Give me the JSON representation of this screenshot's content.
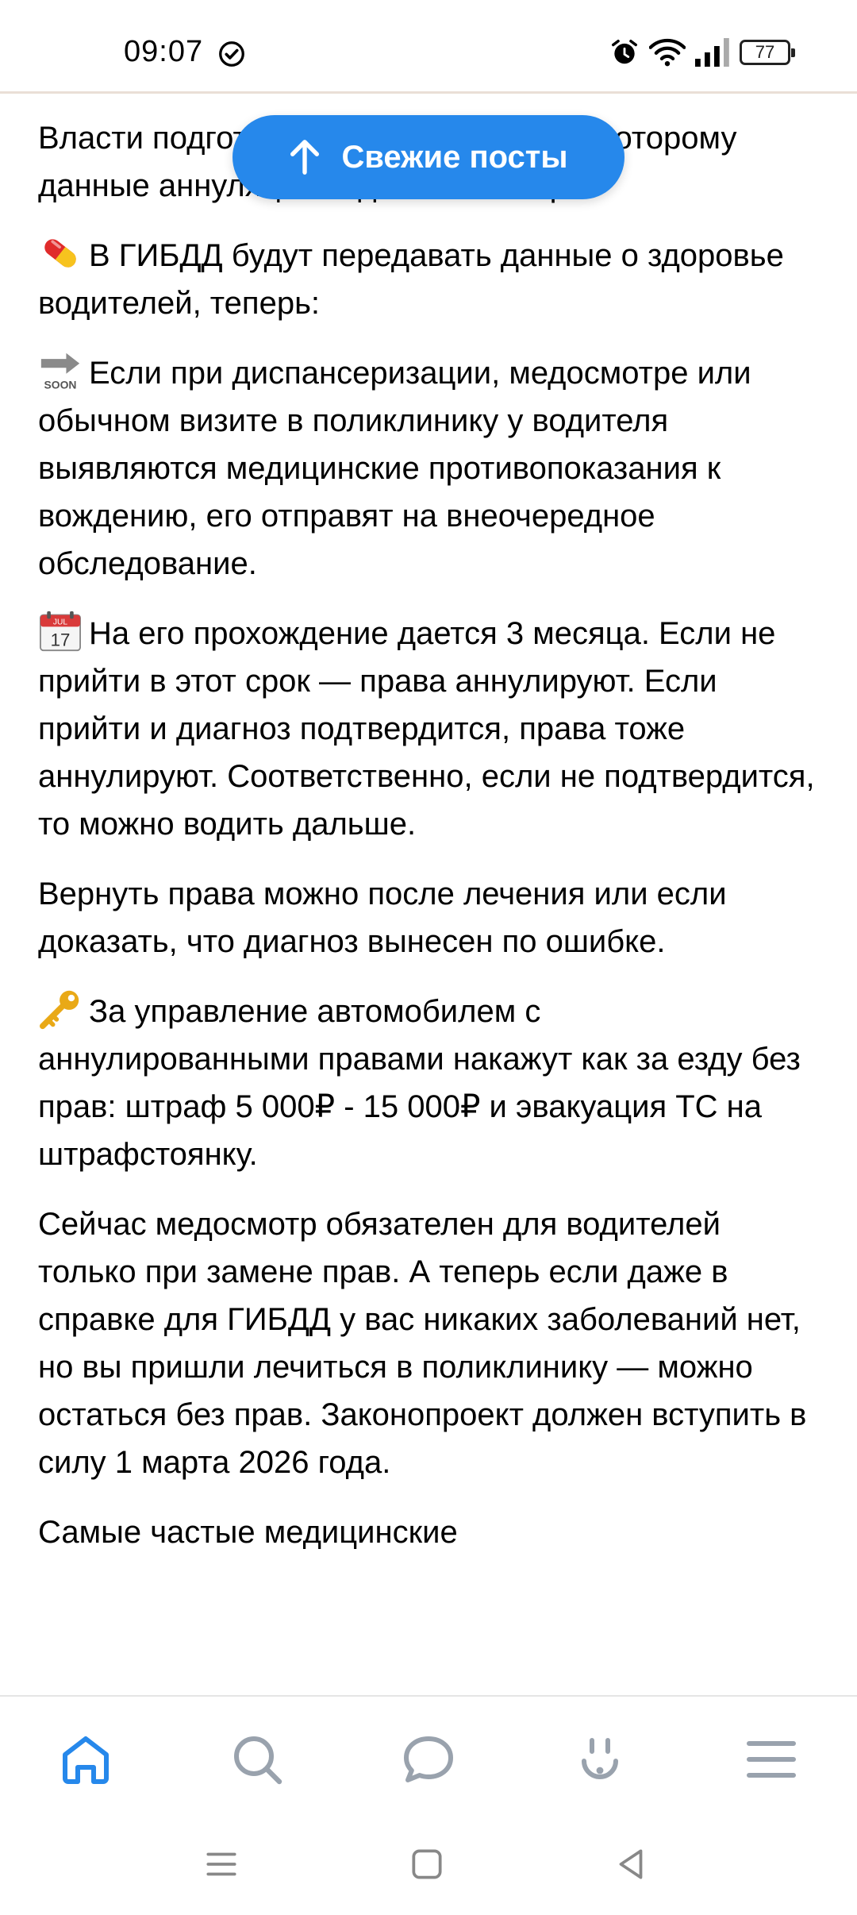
{
  "status_bar": {
    "time": "09:07",
    "battery_level": "77",
    "icons": [
      "check-circle-icon",
      "alarm-icon",
      "wifi-icon",
      "signal-icon",
      "battery-icon"
    ]
  },
  "fresh_posts": {
    "label": "Свежие посты",
    "icon": "arrow-up-icon"
  },
  "article": {
    "paragraphs": [
      {
        "text": "Власти подготовили законопроект, по которому данные аннуляции водительских прав"
      },
      {
        "icon": "pill-emoji",
        "text": "В ГИБДД будут передавать данные о здоровье водителей, теперь:"
      },
      {
        "icon": "soon-arrow-emoji",
        "text": "Если при диспансеризации, медосмотре или обычном визите в поликлинику у водителя выявляются медицинские противопоказания к вождению, его отправят на внеочередное обследование."
      },
      {
        "icon": "calendar-emoji",
        "text": "На его прохождение дается 3 месяца. Если не прийти в этот срок — права аннулируют. Если прийти и диагноз подтвердится, права тоже аннулируют. Соответственно, если не подтвердится, то можно водить дальше."
      },
      {
        "text": "Вернуть права можно после лечения или если доказать, что диагноз вынесен по ошибке."
      },
      {
        "icon": "key-emoji",
        "text": "За управление автомобилем с аннулированными правами накажут как за езду без прав: штраф 5 000₽ - 15 000₽ и эвакуация ТС на штрафстоянку."
      },
      {
        "text": "Сейчас медосмотр обязателен для водителей только при замене прав. А теперь если даже в справке для ГИБДД у вас никаких заболеваний нет, но вы пришли лечиться в поликлинику — можно остаться без прав. Законопроект должен вступить в силу 1 марта 2026 года."
      },
      {
        "text": "Самые частые медицинские"
      }
    ],
    "calendar_month": "JUL",
    "calendar_day": "17",
    "soon_label": "SOON"
  },
  "tabbar": {
    "items": [
      {
        "icon": "home-icon",
        "active": true
      },
      {
        "icon": "search-icon",
        "active": false
      },
      {
        "icon": "chat-icon",
        "active": false
      },
      {
        "icon": "notifications-icon",
        "active": false
      },
      {
        "icon": "menu-icon",
        "active": false
      }
    ],
    "active_color": "#2688eb",
    "inactive_color": "#99a2ad"
  },
  "system_nav": {
    "icons": [
      "recent-apps-icon",
      "home-square-icon",
      "back-icon"
    ]
  }
}
